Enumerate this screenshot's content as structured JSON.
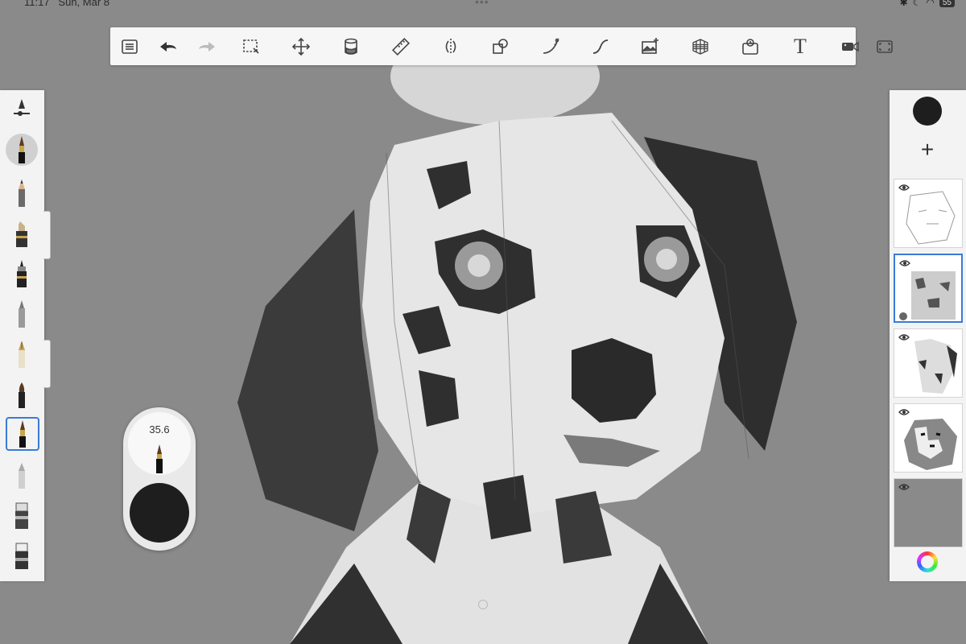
{
  "status_bar": {
    "time": "11:17",
    "date": "Sun, Mar 8",
    "battery": "55"
  },
  "toolbar": {
    "tools": [
      {
        "id": "layers-list",
        "icon": "list-icon"
      },
      {
        "id": "undo",
        "icon": "undo-icon"
      },
      {
        "id": "redo",
        "icon": "redo-icon"
      },
      {
        "id": "selection",
        "icon": "selection-icon"
      },
      {
        "id": "transform",
        "icon": "move-icon"
      },
      {
        "id": "fill",
        "icon": "fill-bucket-icon"
      },
      {
        "id": "ruler",
        "icon": "ruler-icon"
      },
      {
        "id": "symmetry",
        "icon": "symmetry-icon"
      },
      {
        "id": "shapes",
        "icon": "shapes-icon"
      },
      {
        "id": "curve",
        "icon": "curve-icon"
      },
      {
        "id": "stroke",
        "icon": "stroke-icon"
      },
      {
        "id": "import-image",
        "icon": "image-add-icon"
      },
      {
        "id": "perspective",
        "icon": "perspective-grid-icon"
      },
      {
        "id": "time-lapse",
        "icon": "timelapse-icon"
      },
      {
        "id": "text",
        "icon": "text-icon",
        "label": "T"
      },
      {
        "id": "record",
        "icon": "video-icon"
      },
      {
        "id": "fullscreen",
        "icon": "fullscreen-icon"
      }
    ]
  },
  "brushes": [
    {
      "name": "brush-settings",
      "icon": "brush-settings-icon"
    },
    {
      "name": "round-brush",
      "icon": "paint-brush-icon",
      "active": true
    },
    {
      "name": "pencil",
      "icon": "pencil-icon"
    },
    {
      "name": "marker",
      "icon": "marker-icon"
    },
    {
      "name": "ink-pen",
      "icon": "ink-pen-icon"
    },
    {
      "name": "ballpoint",
      "icon": "ballpoint-icon"
    },
    {
      "name": "fountain-pen",
      "icon": "fountain-pen-icon"
    },
    {
      "name": "flat-brush",
      "icon": "flat-brush-icon"
    },
    {
      "name": "paint-brush-selected",
      "icon": "paint-brush-icon",
      "selected": true
    },
    {
      "name": "eraser-soft",
      "icon": "soft-eraser-icon"
    },
    {
      "name": "eraser",
      "icon": "eraser-icon"
    },
    {
      "name": "eraser-hard",
      "icon": "hard-eraser-icon"
    }
  ],
  "puck": {
    "size_value": "35.6",
    "color": "#1e1e1e"
  },
  "layers_panel": {
    "current_color": "#1e1e1e",
    "add_label": "+",
    "layer_count": 5,
    "selected_layer_index": 1
  },
  "colors": {
    "accent": "#3a7bd5",
    "canvas_bg": "#8a8a8a"
  }
}
